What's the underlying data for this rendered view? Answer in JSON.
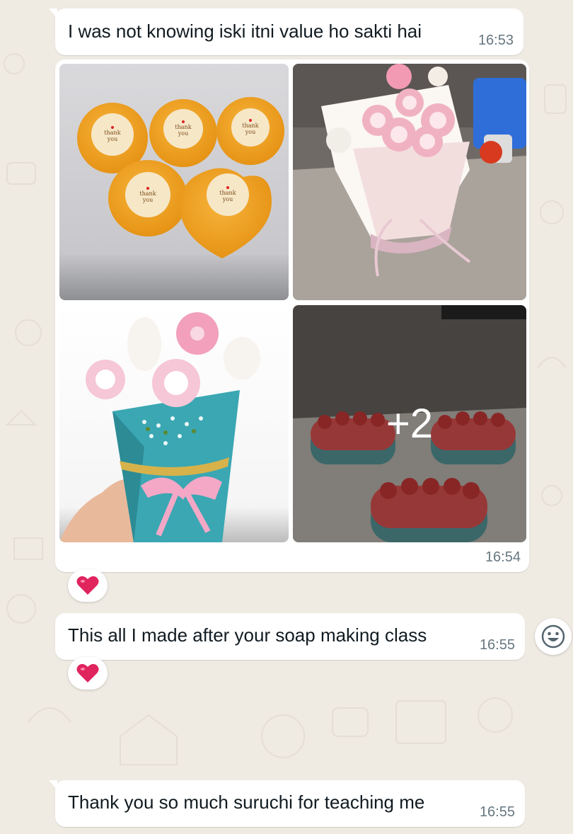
{
  "messages": [
    {
      "text": "I was not knowing iski itni value ho sakti hai",
      "time": "16:53"
    },
    {
      "time": "16:54",
      "more_count": "+2",
      "images": [
        "soap-thank-you-image",
        "soap-bouquet-image",
        "soap-flower-hand-image",
        "watermelon-soap-image"
      ]
    },
    {
      "text": "This all I made after your soap making class",
      "time": "16:55"
    },
    {
      "text": "Thank you so much suruchi for teaching me",
      "time": "16:55"
    }
  ],
  "reactions": [
    {
      "emoji": "heart-icon",
      "color": "#e0245e"
    },
    {
      "emoji": "heart-icon",
      "color": "#e0245e"
    }
  ],
  "icons": {
    "emoji_button": "smiley-icon"
  },
  "colors": {
    "background": "#efeae2",
    "bubble": "#ffffff",
    "meta": "#667781"
  }
}
